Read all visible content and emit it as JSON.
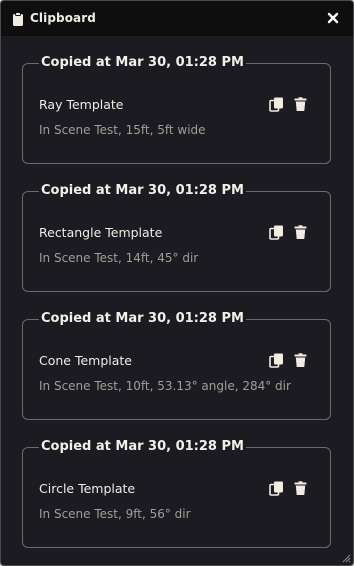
{
  "window": {
    "title": "Clipboard",
    "title_icon": "clipboard-icon",
    "close_icon": "close-icon"
  },
  "entries": [
    {
      "copied_label": "Copied at Mar 30, 01:28 PM",
      "name": "Ray Template",
      "description": "In Scene Test, 15ft, 5ft wide"
    },
    {
      "copied_label": "Copied at Mar 30, 01:28 PM",
      "name": "Rectangle Template",
      "description": "In Scene Test, 14ft, 45° dir"
    },
    {
      "copied_label": "Copied at Mar 30, 01:28 PM",
      "name": "Cone Template",
      "description": "In Scene Test, 10ft, 53.13° angle, 284° dir"
    },
    {
      "copied_label": "Copied at Mar 30, 01:28 PM",
      "name": "Circle Template",
      "description": "In Scene Test, 9ft, 56° dir"
    }
  ],
  "entry_actions": [
    "copy-icon",
    "trash-icon"
  ],
  "colors": {
    "window_bg": "#1c1b22",
    "titlebar_bg": "#0e0e0f",
    "border": "#6e6a66",
    "text_primary": "#f0ece4",
    "text_secondary": "#a39d95"
  }
}
